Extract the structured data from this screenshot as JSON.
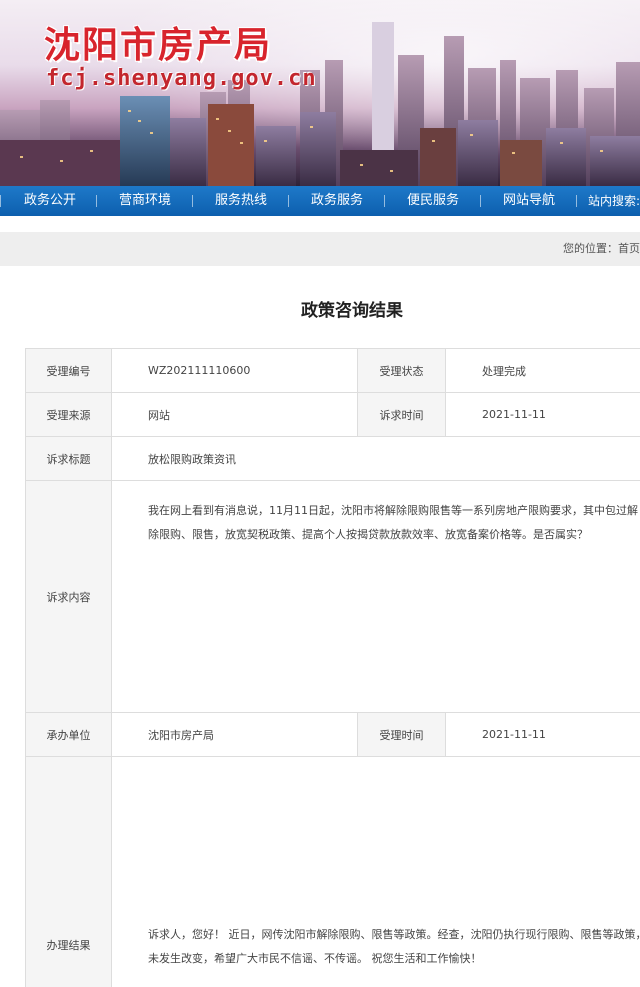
{
  "header": {
    "title": "沈阳市房产局",
    "domain": "fcj.shenyang.gov.cn"
  },
  "nav": {
    "items": [
      "政务公开",
      "营商环境",
      "服务热线",
      "政务服务",
      "便民服务",
      "网站导航"
    ],
    "search_label": "站内搜索:"
  },
  "breadcrumb": {
    "text": "您的位置：首页"
  },
  "page": {
    "title": "政策咨询结果"
  },
  "record": {
    "accept_no_label": "受理编号",
    "accept_no": "WZ202111110600",
    "status_label": "受理状态",
    "status": "处理完成",
    "source_label": "受理来源",
    "source": "网站",
    "request_time_label": "诉求时间",
    "request_time": "2021-11-11",
    "subject_label": "诉求标题",
    "subject": "放松限购政策资讯",
    "content_label": "诉求内容",
    "content": "我在网上看到有消息说，11月11日起，沈阳市将解除限购限售等一系列房地产限购要求，其中包过解除限购、限售，放宽契税政策、提高个人按揭贷款放款效率、放宽备案价格等。是否属实？",
    "handler_label": "承办单位",
    "handler": "沈阳市房产局",
    "accept_time_label": "受理时间",
    "accept_time": "2021-11-11",
    "result_label": "办理结果",
    "result": "诉求人，您好！ 近日，网传沈阳市解除限购、限售等政策。经查，沈阳仍执行现行限购、限售等政策，未发生改变，希望广大市民不信谣、不传谣。 祝您生活和工作愉快！"
  }
}
